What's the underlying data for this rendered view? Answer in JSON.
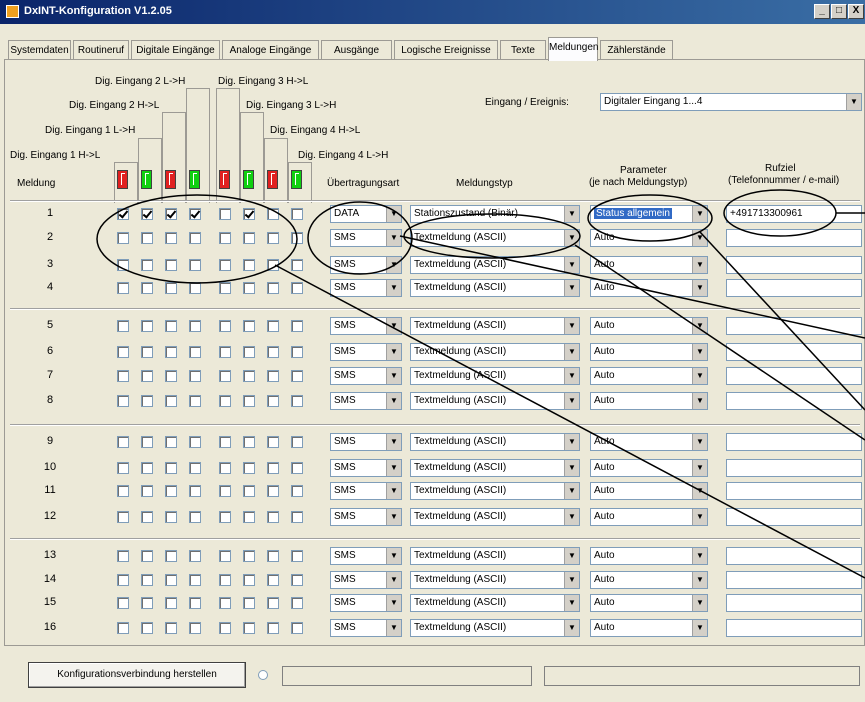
{
  "window": {
    "title": "DxINT-Konfiguration V1.2.05",
    "buttons": [
      "_",
      "□",
      "X"
    ]
  },
  "tabs": [
    {
      "label": "Systemdaten",
      "active": false
    },
    {
      "label": "Routineruf",
      "active": false
    },
    {
      "label": "Digitale Eingänge",
      "active": false
    },
    {
      "label": "Analoge Eingänge",
      "active": false
    },
    {
      "label": "Ausgänge",
      "active": false
    },
    {
      "label": "Logische Ereignisse",
      "active": false
    },
    {
      "label": "Texte",
      "active": false
    },
    {
      "label": "Meldungen",
      "active": true
    },
    {
      "label": "Zählerstände",
      "active": false
    }
  ],
  "headers": {
    "dig2lh": "Dig. Eingang 2 L->H",
    "dig3hl": "Dig. Eingang 3 H->L",
    "dig2hl": "Dig. Eingang 2 H->L",
    "dig3lh": "Dig. Eingang 3 L->H",
    "dig1lh": "Dig. Eingang 1 L->H",
    "dig4hl": "Dig. Eingang 4 H->L",
    "dig1hl": "Dig. Eingang 1 H->L",
    "dig4lh": "Dig. Eingang 4 L->H",
    "meldung": "Meldung",
    "uebertragungsart": "Übertragungsart",
    "meldungstyp": "Meldungstyp",
    "parameter_l1": "Parameter",
    "parameter_l2": "(je nach Meldungstyp)",
    "rufziel_l1": "Rufziel",
    "rufziel_l2": "(Telefonnummer / e-mail)"
  },
  "eingang": {
    "label": "Eingang / Ereignis:",
    "value": "Digitaler Eingang 1...4"
  },
  "switch_colors": [
    "red",
    "green",
    "red",
    "green",
    "red",
    "green",
    "red",
    "green"
  ],
  "colors": {
    "red": "#e02020",
    "green": "#10d010",
    "annotation": "#000000"
  },
  "rows": [
    {
      "num": "1",
      "checks": [
        true,
        true,
        true,
        true,
        false,
        true,
        false,
        false
      ],
      "art": "DATA",
      "typ": "Stationszustand (Binär)",
      "param": "Status allgemein",
      "ziel": "+491713300961"
    },
    {
      "num": "2",
      "checks": [
        false,
        false,
        false,
        false,
        false,
        false,
        false,
        false
      ],
      "art": "SMS",
      "typ": "Textmeldung (ASCII)",
      "param": "Auto",
      "ziel": ""
    },
    {
      "num": "3",
      "checks": [
        false,
        false,
        false,
        false,
        false,
        false,
        false,
        false
      ],
      "art": "SMS",
      "typ": "Textmeldung (ASCII)",
      "param": "Auto",
      "ziel": ""
    },
    {
      "num": "4",
      "checks": [
        false,
        false,
        false,
        false,
        false,
        false,
        false,
        false
      ],
      "art": "SMS",
      "typ": "Textmeldung (ASCII)",
      "param": "Auto",
      "ziel": ""
    },
    {
      "num": "5",
      "checks": [
        false,
        false,
        false,
        false,
        false,
        false,
        false,
        false
      ],
      "art": "SMS",
      "typ": "Textmeldung (ASCII)",
      "param": "Auto",
      "ziel": ""
    },
    {
      "num": "6",
      "checks": [
        false,
        false,
        false,
        false,
        false,
        false,
        false,
        false
      ],
      "art": "SMS",
      "typ": "Textmeldung (ASCII)",
      "param": "Auto",
      "ziel": ""
    },
    {
      "num": "7",
      "checks": [
        false,
        false,
        false,
        false,
        false,
        false,
        false,
        false
      ],
      "art": "SMS",
      "typ": "Textmeldung (ASCII)",
      "param": "Auto",
      "ziel": ""
    },
    {
      "num": "8",
      "checks": [
        false,
        false,
        false,
        false,
        false,
        false,
        false,
        false
      ],
      "art": "SMS",
      "typ": "Textmeldung (ASCII)",
      "param": "Auto",
      "ziel": ""
    },
    {
      "num": "9",
      "checks": [
        false,
        false,
        false,
        false,
        false,
        false,
        false,
        false
      ],
      "art": "SMS",
      "typ": "Textmeldung (ASCII)",
      "param": "Auto",
      "ziel": ""
    },
    {
      "num": "10",
      "checks": [
        false,
        false,
        false,
        false,
        false,
        false,
        false,
        false
      ],
      "art": "SMS",
      "typ": "Textmeldung (ASCII)",
      "param": "Auto",
      "ziel": ""
    },
    {
      "num": "11",
      "checks": [
        false,
        false,
        false,
        false,
        false,
        false,
        false,
        false
      ],
      "art": "SMS",
      "typ": "Textmeldung (ASCII)",
      "param": "Auto",
      "ziel": ""
    },
    {
      "num": "12",
      "checks": [
        false,
        false,
        false,
        false,
        false,
        false,
        false,
        false
      ],
      "art": "SMS",
      "typ": "Textmeldung (ASCII)",
      "param": "Auto",
      "ziel": ""
    },
    {
      "num": "13",
      "checks": [
        false,
        false,
        false,
        false,
        false,
        false,
        false,
        false
      ],
      "art": "SMS",
      "typ": "Textmeldung (ASCII)",
      "param": "Auto",
      "ziel": ""
    },
    {
      "num": "14",
      "checks": [
        false,
        false,
        false,
        false,
        false,
        false,
        false,
        false
      ],
      "art": "SMS",
      "typ": "Textmeldung (ASCII)",
      "param": "Auto",
      "ziel": ""
    },
    {
      "num": "15",
      "checks": [
        false,
        false,
        false,
        false,
        false,
        false,
        false,
        false
      ],
      "art": "SMS",
      "typ": "Textmeldung (ASCII)",
      "param": "Auto",
      "ziel": ""
    },
    {
      "num": "16",
      "checks": [
        false,
        false,
        false,
        false,
        false,
        false,
        false,
        false
      ],
      "art": "SMS",
      "typ": "Textmeldung (ASCII)",
      "param": "Auto",
      "ziel": ""
    }
  ],
  "bottom": {
    "connect_button": "Konfigurationsverbindung herstellen",
    "status1": "",
    "status2": ""
  },
  "icons": {
    "dropdown": "chevron-down-icon",
    "app": "app-icon"
  }
}
